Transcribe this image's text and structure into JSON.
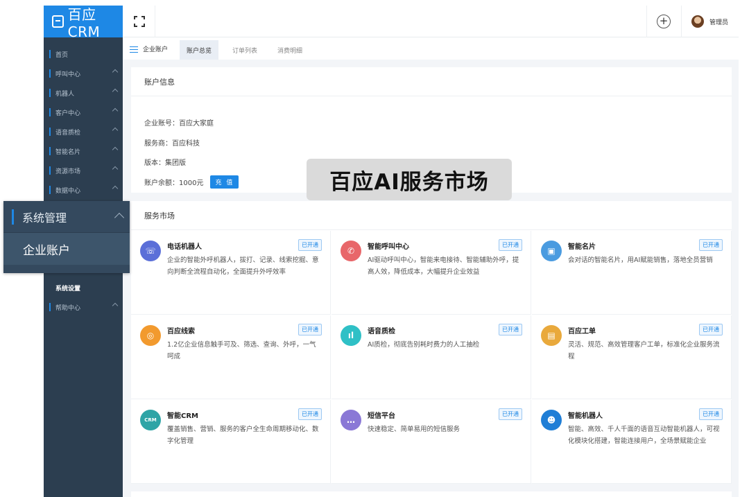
{
  "brand": {
    "title": "百应CRM"
  },
  "sidebar": {
    "items": [
      {
        "label": "首页",
        "expandable": false
      },
      {
        "label": "呼叫中心",
        "expandable": true
      },
      {
        "label": "机器人",
        "expandable": true
      },
      {
        "label": "客户中心",
        "expandable": true
      },
      {
        "label": "语音质检",
        "expandable": true
      },
      {
        "label": "智能名片",
        "expandable": true
      },
      {
        "label": "资源市场",
        "expandable": true
      },
      {
        "label": "数据中心",
        "expandable": true
      }
    ],
    "settings_label": "系统设置",
    "help_label": "帮助中心"
  },
  "overlay_menu": {
    "section": "系统管理",
    "active_item": "企业账户"
  },
  "topbar": {
    "user_name": "管理员"
  },
  "tabs": {
    "lead": "企业账户",
    "items": [
      {
        "label": "账户总览",
        "active": true
      },
      {
        "label": "订单列表"
      },
      {
        "label": "消费明细"
      }
    ]
  },
  "account": {
    "title": "账户信息",
    "company": "企业账号：百应大家庭",
    "provider": "服务商：百应科技",
    "edition": "版本：集团版",
    "balance": "账户余额：1000元",
    "recharge_label": "充 值"
  },
  "market": {
    "title": "服务市场",
    "services": [
      {
        "name": "电话机器人",
        "badge": "已开通",
        "desc": "企业的智能外呼机器人，拔打、记录、线索挖掘、意向判断全流程自动化，全面提升外呼效率",
        "icon": "phone-robot-icon",
        "color": "#5b6fd8",
        "glyph": "☏"
      },
      {
        "name": "智能呼叫中心",
        "badge": "已开通",
        "desc": "AI驱动呼叫中心，智能来电接待、智能辅助外呼，提高人效，降低成本，大幅提升企业效益",
        "icon": "call-center-icon",
        "color": "#e8676a",
        "glyph": "✆"
      },
      {
        "name": "智能名片",
        "badge": "已开通",
        "desc": "会对话的智能名片，用AI赋能销售，落地全员营销",
        "icon": "card-icon",
        "color": "#4a9be0",
        "glyph": "▣"
      },
      {
        "name": "百应线索",
        "badge": "已开通",
        "desc": "1.2亿企业信息触手可及、筛选、查询、外呼，一气呵成",
        "icon": "leads-icon",
        "color": "#f29a2e",
        "glyph": "◎"
      },
      {
        "name": "语音质检",
        "badge": "已开通",
        "desc": "AI质检，彻底告别耗时费力的人工抽检",
        "icon": "voice-qc-icon",
        "color": "#2fc0c6",
        "glyph": "ıl"
      },
      {
        "name": "百应工单",
        "badge": "已开通",
        "desc": "灵活、规范、高效管理客户工单，标准化企业服务流程",
        "icon": "ticket-icon",
        "color": "#e9a93c",
        "glyph": "▤"
      },
      {
        "name": "智能CRM",
        "badge": "已开通",
        "desc": "覆盖销售、营销、服务的客户全生命周期移动化、数字化管理",
        "icon": "crm-icon",
        "color": "#2ea4a6",
        "glyph": "CRM"
      },
      {
        "name": "短信平台",
        "badge": "已开通",
        "desc": "快速稳定、简单易用的短信服务",
        "icon": "sms-icon",
        "color": "#8a78d6",
        "glyph": "…"
      },
      {
        "name": "智能机器人",
        "badge": "已开通",
        "desc": "智能、高效、千人千面的语音互动智能机器人，可视化模块化搭建，智能连接用户，全场景赋能企业",
        "icon": "robot-icon",
        "color": "#1f7ed6",
        "glyph": "☻"
      }
    ]
  },
  "caption": "百应AI服务市场"
}
